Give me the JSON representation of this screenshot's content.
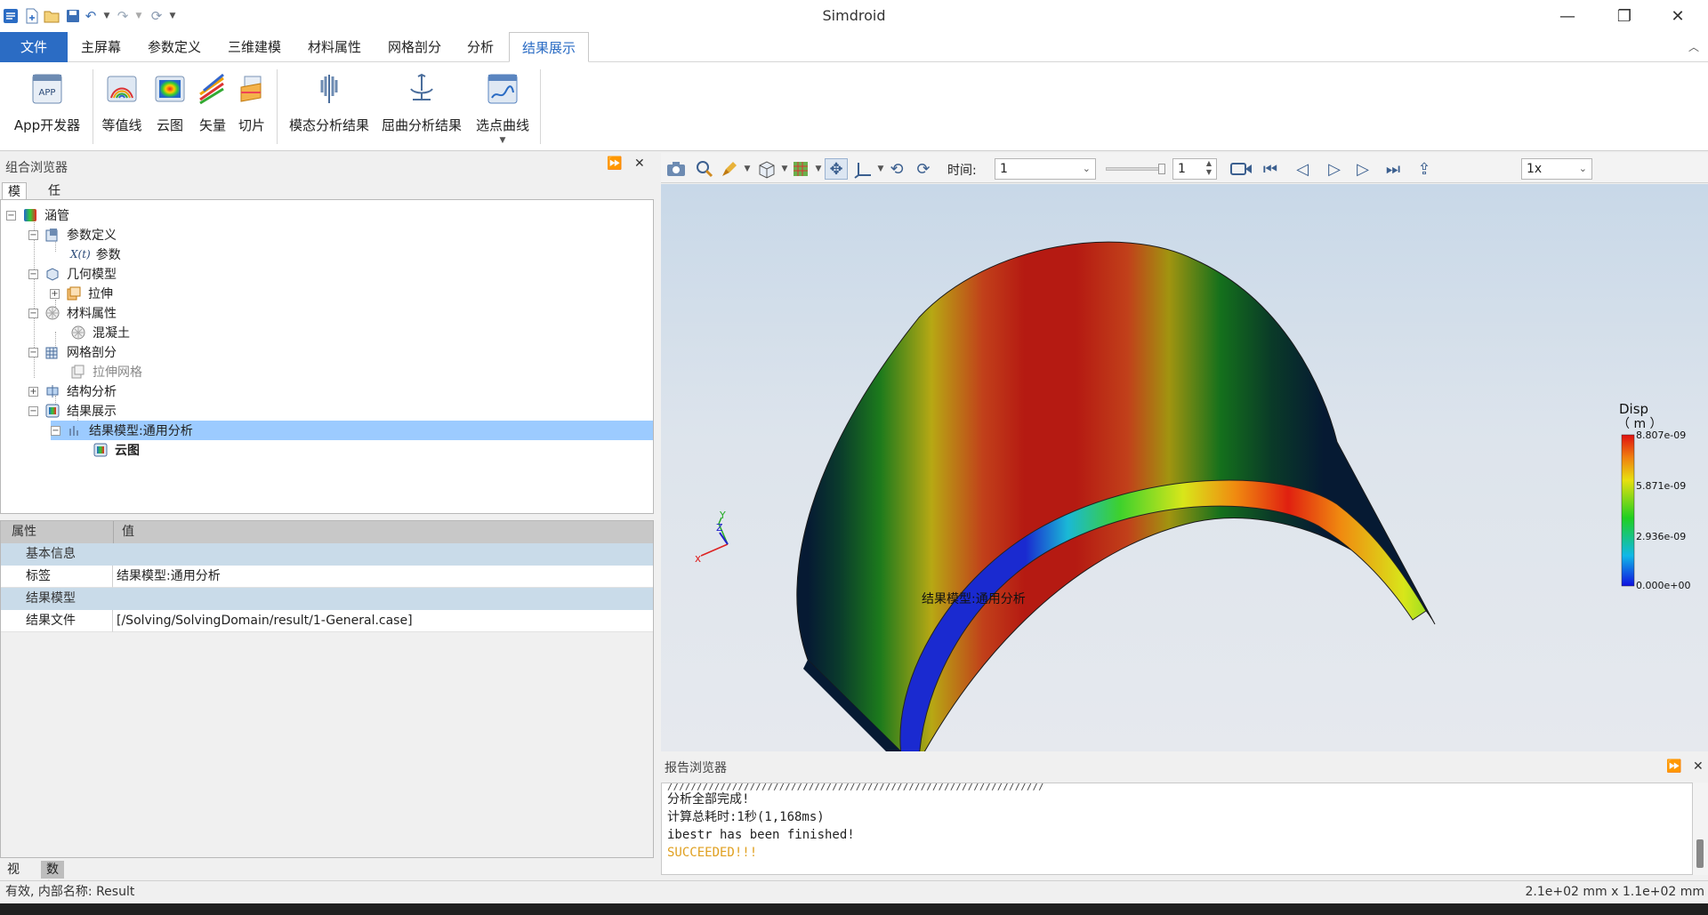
{
  "app": {
    "title": "Simdroid"
  },
  "ribbon_tabs": [
    {
      "label": "文件"
    },
    {
      "label": "主屏幕"
    },
    {
      "label": "参数定义"
    },
    {
      "label": "三维建模"
    },
    {
      "label": "材料属性"
    },
    {
      "label": "网格剖分"
    },
    {
      "label": "分析"
    },
    {
      "label": "结果展示"
    }
  ],
  "ribbon_active_tab": "结果展示",
  "ribbon_buttons": [
    {
      "label": "App开发器",
      "icon": "app-developer-icon"
    },
    {
      "label": "等值线",
      "icon": "contour-line-icon"
    },
    {
      "label": "云图",
      "icon": "cloud-map-icon"
    },
    {
      "label": "矢量",
      "icon": "vector-icon"
    },
    {
      "label": "切片",
      "icon": "slice-icon"
    },
    {
      "label": "模态分析结果",
      "icon": "modal-result-icon"
    },
    {
      "label": "屈曲分析结果",
      "icon": "buckling-result-icon"
    },
    {
      "label": "选点曲线",
      "icon": "point-curve-icon"
    }
  ],
  "combo_browser": {
    "title": "组合浏览器",
    "tabs": [
      {
        "label": "模型"
      },
      {
        "label": "任务"
      }
    ],
    "tree": [
      {
        "label": "涵管"
      },
      {
        "label": "参数定义"
      },
      {
        "label": "参数",
        "prefix": "X(t)"
      },
      {
        "label": "几何模型"
      },
      {
        "label": "拉伸"
      },
      {
        "label": "材料属性"
      },
      {
        "label": "混凝土"
      },
      {
        "label": "网格剖分"
      },
      {
        "label": "拉伸网格"
      },
      {
        "label": "结构分析"
      },
      {
        "label": "结果展示"
      },
      {
        "label": "结果模型:通用分析"
      },
      {
        "label": "云图"
      }
    ]
  },
  "properties": {
    "headers": {
      "property": "属性",
      "value": "值"
    },
    "groups": [
      {
        "name": "基本信息",
        "rows": [
          {
            "key": "标签",
            "value": "结果模型:通用分析"
          }
        ]
      },
      {
        "name": "结果模型",
        "rows": [
          {
            "key": "结果文件",
            "value": "[/Solving/SolvingDomain/result/1-General.case]"
          }
        ]
      }
    ]
  },
  "bottom_tabs": [
    {
      "label": "视图"
    },
    {
      "label": "数据"
    }
  ],
  "viewer": {
    "time_label": "时间:",
    "time_value": "1",
    "frame_value": "1",
    "speed_value": "1x",
    "model_label": "结果模型:通用分析",
    "axes": {
      "x": "x",
      "y": "Y",
      "z": "Z"
    },
    "legend": {
      "title": "Disp",
      "unit": "（ m ）",
      "max": "8.807e-09",
      "mid_high": "5.871e-09",
      "mid_low": "2.936e-09",
      "min": "0.000e+00"
    }
  },
  "report": {
    "title": "报告浏览器",
    "separator": "////////////////////////////////////////////////////////////////",
    "lines": [
      "分析全部完成!",
      "计算总耗时:1秒(1,168ms)",
      "ibestr has been finished!",
      "SUCCEEDED!!!"
    ],
    "success_color": "#e0a020"
  },
  "status": {
    "left": "有效, 内部名称: Result",
    "right": "2.1e+02 mm x 1.1e+02 mm"
  }
}
